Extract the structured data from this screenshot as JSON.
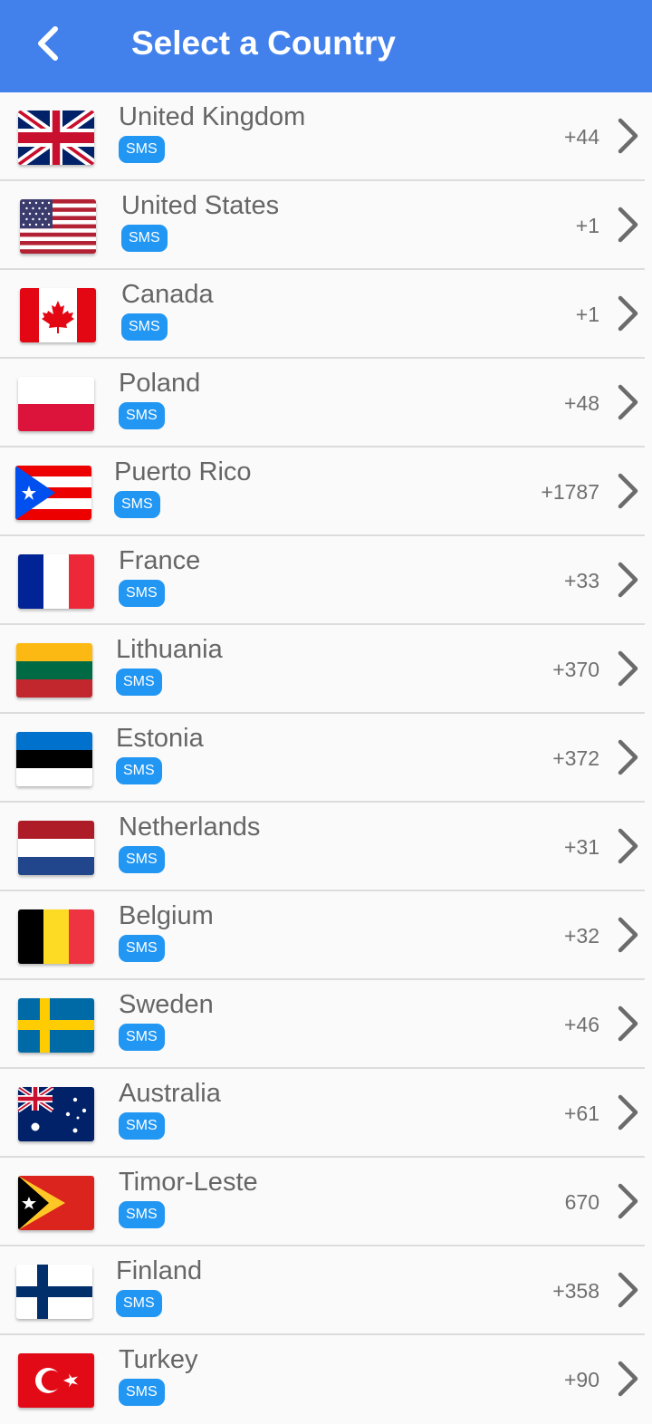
{
  "header": {
    "title": "Select a Country",
    "background": "#4281ec"
  },
  "sms_badge_color": "#2196f3",
  "countries": [
    {
      "name": "United Kingdom",
      "badge": "SMS",
      "code": "+44",
      "flag_icon": "uk-flag-icon"
    },
    {
      "name": "United States",
      "badge": "SMS",
      "code": "+1",
      "flag_icon": "us-flag-icon"
    },
    {
      "name": "Canada",
      "badge": "SMS",
      "code": "+1",
      "flag_icon": "canada-flag-icon"
    },
    {
      "name": "Poland",
      "badge": "SMS",
      "code": "+48",
      "flag_icon": "poland-flag-icon"
    },
    {
      "name": "Puerto Rico",
      "badge": "SMS",
      "code": "+1787",
      "flag_icon": "puerto-rico-flag-icon"
    },
    {
      "name": "France",
      "badge": "SMS",
      "code": "+33",
      "flag_icon": "france-flag-icon"
    },
    {
      "name": "Lithuania",
      "badge": "SMS",
      "code": "+370",
      "flag_icon": "lithuania-flag-icon"
    },
    {
      "name": "Estonia",
      "badge": "SMS",
      "code": "+372",
      "flag_icon": "estonia-flag-icon"
    },
    {
      "name": "Netherlands",
      "badge": "SMS",
      "code": "+31",
      "flag_icon": "netherlands-flag-icon"
    },
    {
      "name": "Belgium",
      "badge": "SMS",
      "code": "+32",
      "flag_icon": "belgium-flag-icon"
    },
    {
      "name": "Sweden",
      "badge": "SMS",
      "code": "+46",
      "flag_icon": "sweden-flag-icon"
    },
    {
      "name": "Australia",
      "badge": "SMS",
      "code": "+61",
      "flag_icon": "australia-flag-icon"
    },
    {
      "name": "Timor-Leste",
      "badge": "SMS",
      "code": "670",
      "flag_icon": "timor-leste-flag-icon"
    },
    {
      "name": "Finland",
      "badge": "SMS",
      "code": "+358",
      "flag_icon": "finland-flag-icon"
    },
    {
      "name": "Turkey",
      "badge": "SMS",
      "code": "+90",
      "flag_icon": "turkey-flag-icon"
    }
  ]
}
